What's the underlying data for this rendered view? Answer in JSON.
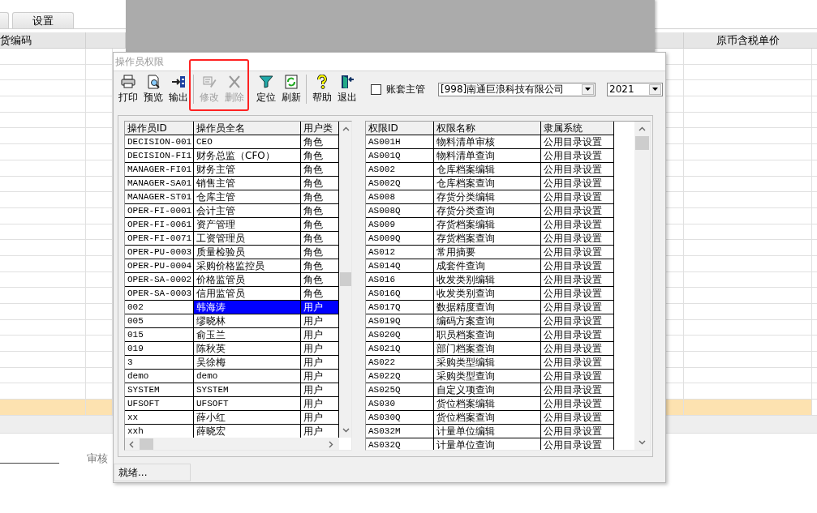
{
  "background": {
    "tabs": [
      {
        "selected": false
      },
      {
        "label": "设置",
        "selected": false
      }
    ],
    "table": {
      "columns": [
        "货编码",
        "原币含税单价"
      ],
      "rows": [
        {
          "selected": false
        },
        {
          "selected": false
        },
        {
          "selected": false
        },
        {
          "selected": false
        },
        {
          "selected": false
        },
        {
          "selected": false
        },
        {
          "selected": false
        },
        {
          "selected": false
        },
        {
          "selected": false
        },
        {
          "selected": false
        },
        {
          "selected": false
        },
        {
          "selected": false
        },
        {
          "selected": false
        },
        {
          "selected": false
        },
        {
          "selected": false
        },
        {
          "selected": false
        },
        {
          "selected": false
        },
        {
          "selected": false
        },
        {
          "selected": false
        },
        {
          "selected": false
        },
        {
          "selected": false
        },
        {
          "selected": false
        },
        {
          "selected": true
        }
      ]
    },
    "reviewer_label": "审核"
  },
  "dialog": {
    "title": "操作员权限",
    "toolbar": [
      [
        {
          "label": "打印",
          "disabled": false
        },
        {
          "label": "预览",
          "disabled": false
        },
        {
          "label": "输出",
          "disabled": false
        }
      ],
      [
        {
          "label": "修改",
          "disabled": true
        },
        {
          "label": "删除",
          "disabled": true
        },
        {
          "label": "定位",
          "disabled": false
        },
        {
          "label": "刷新",
          "disabled": false
        }
      ],
      [
        {
          "label": "帮助",
          "disabled": false
        },
        {
          "label": "退出",
          "disabled": false
        }
      ]
    ],
    "admin_checkbox": {
      "label": "账套主管",
      "checked": false
    },
    "account_select": {
      "value": "[998]南通巨浪科技有限公司"
    },
    "year_select": {
      "value": "2021"
    },
    "operators": {
      "columns": [
        "操作员ID",
        "操作员全名",
        "用户类"
      ],
      "rows": [
        {
          "cells": [
            "DECISION-001",
            "CEO",
            "角色"
          ],
          "selected": false
        },
        {
          "cells": [
            "DECISION-FI1",
            "财务总监（CFO）",
            "角色"
          ],
          "selected": false
        },
        {
          "cells": [
            "MANAGER-FI01",
            "财务主管",
            "角色"
          ],
          "selected": false
        },
        {
          "cells": [
            "MANAGER-SA01",
            "销售主管",
            "角色"
          ],
          "selected": false
        },
        {
          "cells": [
            "MANAGER-ST01",
            "仓库主管",
            "角色"
          ],
          "selected": false
        },
        {
          "cells": [
            "OPER-FI-0001",
            "会计主管",
            "角色"
          ],
          "selected": false
        },
        {
          "cells": [
            "OPER-FI-0061",
            "资产管理",
            "角色"
          ],
          "selected": false
        },
        {
          "cells": [
            "OPER-FI-0071",
            "工资管理员",
            "角色"
          ],
          "selected": false
        },
        {
          "cells": [
            "OPER-PU-0003",
            "质量检验员",
            "角色"
          ],
          "selected": false
        },
        {
          "cells": [
            "OPER-PU-0004",
            "采购价格监控员",
            "角色"
          ],
          "selected": false
        },
        {
          "cells": [
            "OPER-SA-0002",
            "价格监管员",
            "角色"
          ],
          "selected": false
        },
        {
          "cells": [
            "OPER-SA-0003",
            "信用监管员",
            "角色"
          ],
          "selected": false
        },
        {
          "cells": [
            "002",
            "韩海涛",
            "用户"
          ],
          "selected": true
        },
        {
          "cells": [
            "005",
            "缪晓林",
            "用户"
          ],
          "selected": false
        },
        {
          "cells": [
            "015",
            "俞玉兰",
            "用户"
          ],
          "selected": false
        },
        {
          "cells": [
            "019",
            "陈秋英",
            "用户"
          ],
          "selected": false
        },
        {
          "cells": [
            "3",
            "吴徐梅",
            "用户"
          ],
          "selected": false
        },
        {
          "cells": [
            "demo",
            "demo",
            "用户"
          ],
          "selected": false
        },
        {
          "cells": [
            "SYSTEM",
            "SYSTEM",
            "用户"
          ],
          "selected": false
        },
        {
          "cells": [
            "UFSOFT",
            "UFSOFT",
            "用户"
          ],
          "selected": false
        },
        {
          "cells": [
            "xx",
            "薛小红",
            "用户"
          ],
          "selected": false
        },
        {
          "cells": [
            "xxh",
            "薛晓宏",
            "用户"
          ],
          "selected": false
        }
      ]
    },
    "permissions": {
      "columns": [
        "权限ID",
        "权限名称",
        "隶属系统"
      ],
      "rows": [
        [
          "AS001H",
          "物料清单审核",
          "公用目录设置"
        ],
        [
          "AS001Q",
          "物料清单查询",
          "公用目录设置"
        ],
        [
          "AS002",
          "仓库档案编辑",
          "公用目录设置"
        ],
        [
          "AS002Q",
          "仓库档案查询",
          "公用目录设置"
        ],
        [
          "AS008",
          "存货分类编辑",
          "公用目录设置"
        ],
        [
          "AS008Q",
          "存货分类查询",
          "公用目录设置"
        ],
        [
          "AS009",
          "存货档案编辑",
          "公用目录设置"
        ],
        [
          "AS009Q",
          "存货档案查询",
          "公用目录设置"
        ],
        [
          "AS012",
          "常用摘要",
          "公用目录设置"
        ],
        [
          "AS014Q",
          "成套件查询",
          "公用目录设置"
        ],
        [
          "AS016",
          "收发类别编辑",
          "公用目录设置"
        ],
        [
          "AS016Q",
          "收发类别查询",
          "公用目录设置"
        ],
        [
          "AS017Q",
          "数据精度查询",
          "公用目录设置"
        ],
        [
          "AS019Q",
          "编码方案查询",
          "公用目录设置"
        ],
        [
          "AS020Q",
          "职员档案查询",
          "公用目录设置"
        ],
        [
          "AS021Q",
          "部门档案查询",
          "公用目录设置"
        ],
        [
          "AS022",
          "采购类型编辑",
          "公用目录设置"
        ],
        [
          "AS022Q",
          "采购类型查询",
          "公用目录设置"
        ],
        [
          "AS025Q",
          "自定义项查询",
          "公用目录设置"
        ],
        [
          "AS030",
          "货位档案编辑",
          "公用目录设置"
        ],
        [
          "AS030Q",
          "货位档案查询",
          "公用目录设置"
        ],
        [
          "AS032M",
          "计量单位编辑",
          "公用目录设置"
        ],
        [
          "AS032Q",
          "计量单位查询",
          "公用目录设置"
        ]
      ]
    },
    "status": "就绪..."
  }
}
